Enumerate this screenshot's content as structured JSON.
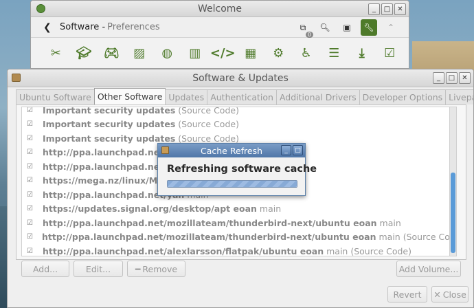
{
  "welcome": {
    "title": "Welcome",
    "header": {
      "back_icon": "arrow-left-icon",
      "title": "Software -",
      "subtitle": "Preferences",
      "badge": "0"
    },
    "header_icons": [
      "copy-icon",
      "search-icon",
      "screenshot-icon",
      "wrench-icon",
      "chevron-up-icon"
    ],
    "categories": [
      "scissors-icon",
      "graduation-cap-icon",
      "gamepad-icon",
      "image-icon",
      "globe-icon",
      "bar-chart-icon",
      "code-icon",
      "film-icon",
      "gear-icon",
      "accessibility-icon",
      "server-icon",
      "download-icon",
      "checkbox-icon"
    ]
  },
  "swu": {
    "title": "Software & Updates",
    "tabs": [
      "Ubuntu Software",
      "Other Software",
      "Updates",
      "Authentication",
      "Additional Drivers",
      "Developer Options",
      "Livepatch"
    ],
    "selected_tab": "Other Software",
    "sources": [
      {
        "url": "Important security updates",
        "rest": "(Source Code)"
      },
      {
        "url": "Important security updates",
        "rest": "(Source Code)"
      },
      {
        "url": "Important security updates",
        "rest": "(Source Code)"
      },
      {
        "url": "http://ppa.launchpad.net/alex",
        "rest": ""
      },
      {
        "url": "http://ppa.launchpad.net/alex",
        "rest": "(Source Code)"
      },
      {
        "url": "https://mega.nz/linux/MEGAs",
        "rest": ""
      },
      {
        "url": "http://ppa.launchpad.net/yan",
        "rest": "main"
      },
      {
        "url": "https://updates.signal.org/desktop/apt eoan",
        "rest": "main"
      },
      {
        "url": "http://ppa.launchpad.net/mozillateam/thunderbird-next/ubuntu eoan",
        "rest": "main"
      },
      {
        "url": "http://ppa.launchpad.net/mozillateam/thunderbird-next/ubuntu eoan",
        "rest": "main (Source Code)"
      },
      {
        "url": "http://ppa.launchpad.net/alexlarsson/flatpak/ubuntu eoan",
        "rest": "main (Source Code)"
      }
    ],
    "buttons": {
      "add": "Add...",
      "edit": "Edit...",
      "remove": "Remove",
      "add_volume": "Add Volume...",
      "revert": "Revert",
      "close": "Close"
    }
  },
  "cache": {
    "title": "Cache Refresh",
    "message": "Refreshing software cache",
    "progress": 1.0
  },
  "colors": {
    "accent_green": "#4e7a2a",
    "progress_blue": "#87aad6",
    "dialog_title": "#4f76a8"
  }
}
